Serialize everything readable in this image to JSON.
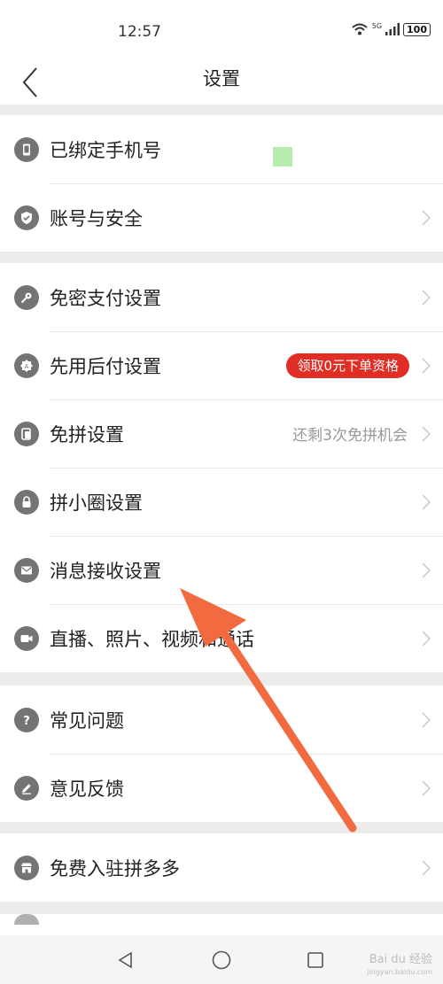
{
  "status_bar": {
    "time": "12:57",
    "network": "5G",
    "battery": "100"
  },
  "header": {
    "title": "设置"
  },
  "groups": [
    {
      "items": [
        {
          "label": "已绑定手机号",
          "icon": "phone-icon"
        },
        {
          "label": "账号与安全",
          "icon": "shield-check-icon"
        }
      ]
    },
    {
      "items": [
        {
          "label": "免密支付设置",
          "icon": "key-icon"
        },
        {
          "label": "先用后付设置",
          "icon": "badge-icon",
          "badge": "领取0元下单资格"
        },
        {
          "label": "免拼设置",
          "icon": "cards-icon",
          "value": "还剩3次免拼机会"
        },
        {
          "label": "拼小圈设置",
          "icon": "lock-icon"
        },
        {
          "label": "消息接收设置",
          "icon": "mail-icon"
        },
        {
          "label": "直播、照片、视频和通话",
          "icon": "video-icon"
        }
      ]
    },
    {
      "items": [
        {
          "label": "常见问题",
          "icon": "question-icon"
        },
        {
          "label": "意见反馈",
          "icon": "pencil-icon"
        }
      ]
    },
    {
      "items": [
        {
          "label": "免费入驻拼多多",
          "icon": "store-icon"
        }
      ]
    }
  ],
  "watermark": {
    "brand": "Bai du 经验",
    "url": "jingyan.baidu.com"
  },
  "colors": {
    "badge": "#e02e24",
    "icon": "#747474",
    "arrow": "#f26a3f"
  }
}
